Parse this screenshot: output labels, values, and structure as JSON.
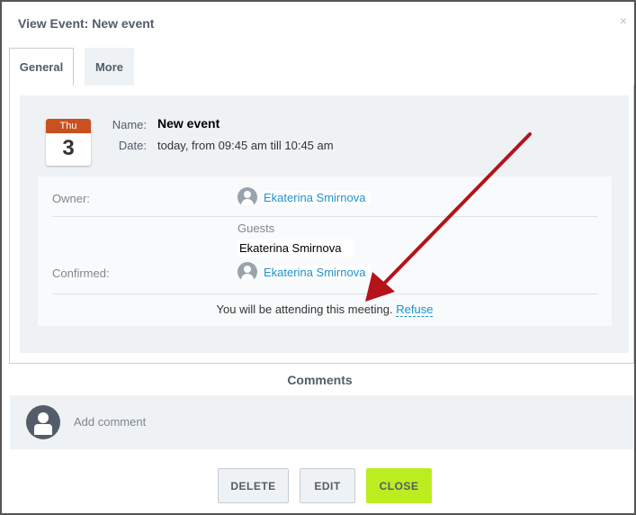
{
  "dialog": {
    "title": "View Event: New event",
    "close_glyph": "×"
  },
  "tabs": [
    {
      "label": "General",
      "active": true
    },
    {
      "label": "More",
      "active": false
    }
  ],
  "event": {
    "calendar_weekday": "Thu",
    "calendar_day": "3",
    "name_label": "Name:",
    "name_value": "New event",
    "date_label": "Date:",
    "date_value": "today, from 09:45 am till 10:45 am"
  },
  "attendees": {
    "owner_label": "Owner:",
    "owner_name": "Ekaterina Smirnova",
    "guests_title": "Guests",
    "guest_name": "Ekaterina Smirnova",
    "confirmed_label": "Confirmed:",
    "confirmed_name": "Ekaterina Smirnova",
    "attending_text": "You will be attending this meeting.",
    "refuse_label": "Refuse"
  },
  "comments": {
    "title": "Comments",
    "placeholder": "Add comment"
  },
  "buttons": {
    "delete_label": "DELETE",
    "edit_label": "EDIT",
    "close_label": "CLOSE"
  },
  "colors": {
    "accent_green": "#bbed21",
    "link_blue": "#2093c9",
    "annotation_arrow": "#b5121b",
    "calendar_header": "#c8511f"
  },
  "icons": {
    "close": "close-icon",
    "user_avatar": "user-avatar-icon",
    "annotation": "red-arrow-annotation"
  }
}
